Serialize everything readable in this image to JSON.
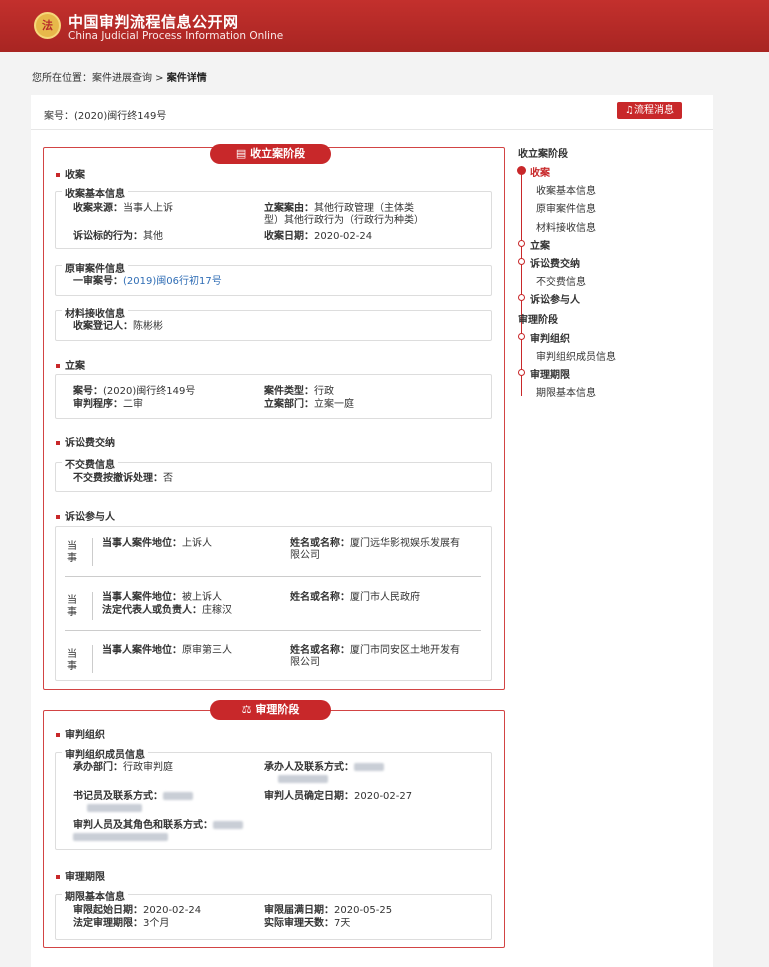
{
  "site": {
    "title": "中国审判流程信息公开网",
    "subtitle": "China Judicial Process Information Online",
    "emblem": "法"
  },
  "breadcrumb": {
    "prefix": "您所在位置：",
    "link": "案件进展查询",
    "sep": " > ",
    "current": "案件详情"
  },
  "case": {
    "number_label": "案号：(2020)闽行终149号"
  },
  "message_button": "流程消息",
  "stage1": {
    "tab": "收立案阶段",
    "intake": {
      "heading": "收案",
      "basic": {
        "title": "收案基本信息",
        "source_label": "收案来源：",
        "source": "当事人上诉",
        "cause_label": "立案案由：",
        "cause": "其他行政管理（主体类型）其他行政行为（行政行为种类）",
        "cause_line1": "其他行政管理（主体类",
        "cause_line2": "型）其他行政行为（行政行为种类）",
        "act_label": "诉讼标的行为：",
        "act": "其他",
        "date_label": "收案日期：",
        "date": "2020-02-24"
      },
      "original": {
        "title": "原审案件信息",
        "first_label": "一审案号：",
        "first_no": "(2019)闽06行初17号"
      },
      "material": {
        "title": "材料接收信息",
        "reg_label": "收案登记人：",
        "reg": "陈彬彬"
      }
    },
    "filing": {
      "heading": "立案",
      "no_label": "案号：",
      "no": "(2020)闽行终149号",
      "type_label": "案件类型：",
      "type": "行政",
      "proc_label": "审判程序：",
      "proc": "二审",
      "dept_label": "立案部门：",
      "dept": "立案一庭"
    },
    "fee": {
      "heading": "诉讼费交纳",
      "title": "不交费信息",
      "label": "不交费按撤诉处理：",
      "value": "否"
    },
    "parties": {
      "heading": "诉讼参与人",
      "tag": "当事",
      "rows": [
        {
          "role_label": "当事人案件地位：",
          "role": "上诉人",
          "rep_label": "",
          "rep": "",
          "name_label": "姓名或名称：",
          "name1": "厦门远华影视娱乐发展有",
          "name2": "限公司"
        },
        {
          "role_label": "当事人案件地位：",
          "role": "被上诉人",
          "rep_label": "法定代表人或负责人：",
          "rep": "庄稼汉",
          "name_label": "姓名或名称：",
          "name1": "厦门市人民政府",
          "name2": ""
        },
        {
          "role_label": "当事人案件地位：",
          "role": "原审第三人",
          "rep_label": "",
          "rep": "",
          "name_label": "姓名或名称：",
          "name1": "厦门市同安区土地开发有",
          "name2": "限公司"
        }
      ]
    }
  },
  "stage2": {
    "tab": "审理阶段",
    "org": {
      "heading": "审判组织",
      "title": "审判组织成员信息",
      "dept_label": "承办部门：",
      "dept": "行政审判庭",
      "judge_label": "承办人及联系方式：",
      "clerk_label": "书记员及联系方式：",
      "confirm_label": "审判人员确定日期：",
      "confirm": "2020-02-27",
      "members_label": "审判人员及其角色和联系方式："
    },
    "period": {
      "heading": "审理期限",
      "title": "期限基本信息",
      "start_label": "审限起始日期：",
      "start": "2020-02-24",
      "end_label": "审限届满日期：",
      "end": "2020-05-25",
      "legal_label": "法定审理期限：",
      "legal": "3个月",
      "actual_label": "实际审理天数：",
      "actual": "7天"
    }
  },
  "sidenav": {
    "stage1": "收立案阶段",
    "intake": "收案",
    "intake_items": [
      "收案基本信息",
      "原审案件信息",
      "材料接收信息"
    ],
    "filing": "立案",
    "fee": "诉讼费交纳",
    "fee_items": [
      "不交费信息"
    ],
    "parties": "诉讼参与人",
    "stage2": "审理阶段",
    "org": "审判组织",
    "org_items": [
      "审判组织成员信息"
    ],
    "period": "审理期限",
    "period_items": [
      "期限基本信息"
    ]
  },
  "colors": {
    "brand": "#c8282a",
    "link": "#2f6db5"
  }
}
